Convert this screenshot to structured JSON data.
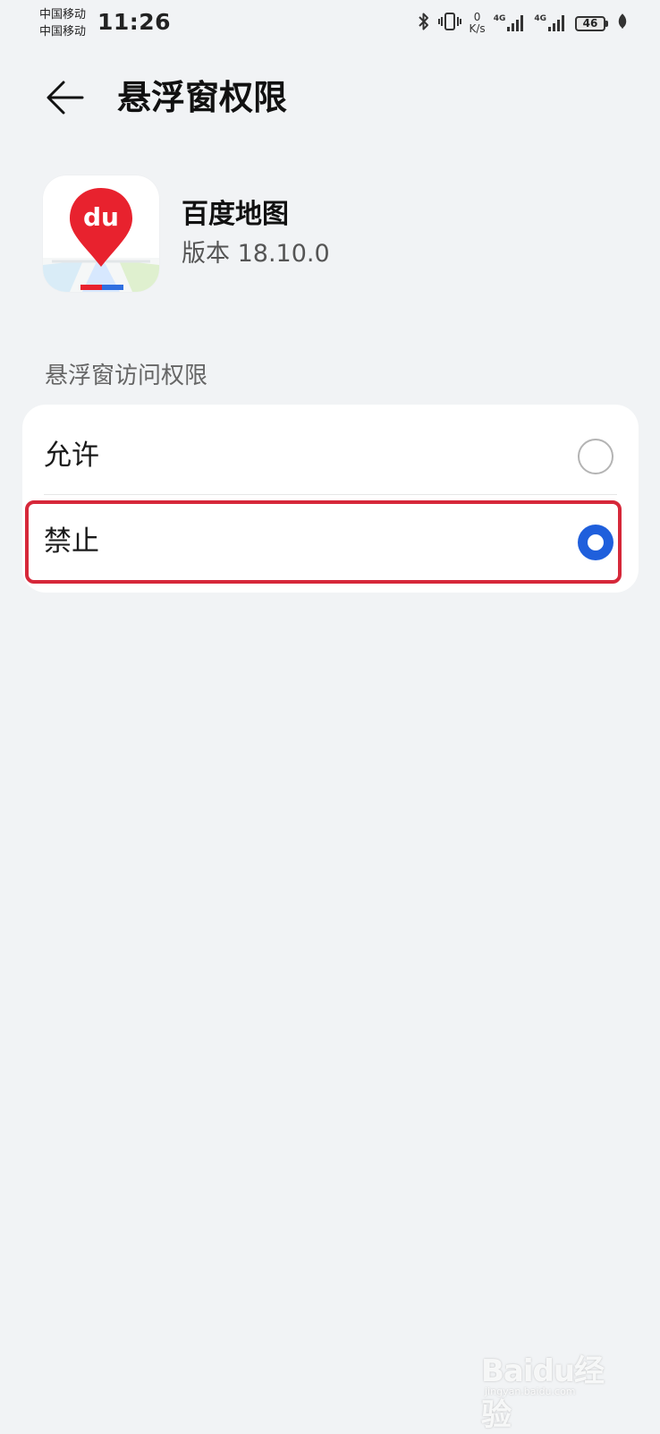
{
  "status_bar": {
    "carrier_1": "中国移动",
    "carrier_2": "中国移动",
    "time": "11:26",
    "net_speed_value": "0",
    "net_speed_unit": "K/s",
    "signal_1_label": "4G",
    "signal_2_label": "4G",
    "battery": "46",
    "icons": [
      "bluetooth-icon",
      "vibrate-icon",
      "signal-icon",
      "battery-icon",
      "leaf-icon"
    ]
  },
  "header": {
    "title": "悬浮窗权限",
    "back_icon": "arrow-left-icon"
  },
  "app": {
    "name": "百度地图",
    "version": "版本 18.10.0",
    "icon_text": "du",
    "icon_color": "#e8222e"
  },
  "section": {
    "title": "悬浮窗访问权限",
    "options": [
      {
        "label": "允许",
        "selected": false
      },
      {
        "label": "禁止",
        "selected": true
      }
    ]
  },
  "colors": {
    "background": "#f1f3f5",
    "card": "#ffffff",
    "radio_selected": "#1f5fdc",
    "highlight": "#d6283a"
  },
  "watermark": {
    "text": "Baidu经验",
    "sub": "jingyan.baidu.com"
  }
}
